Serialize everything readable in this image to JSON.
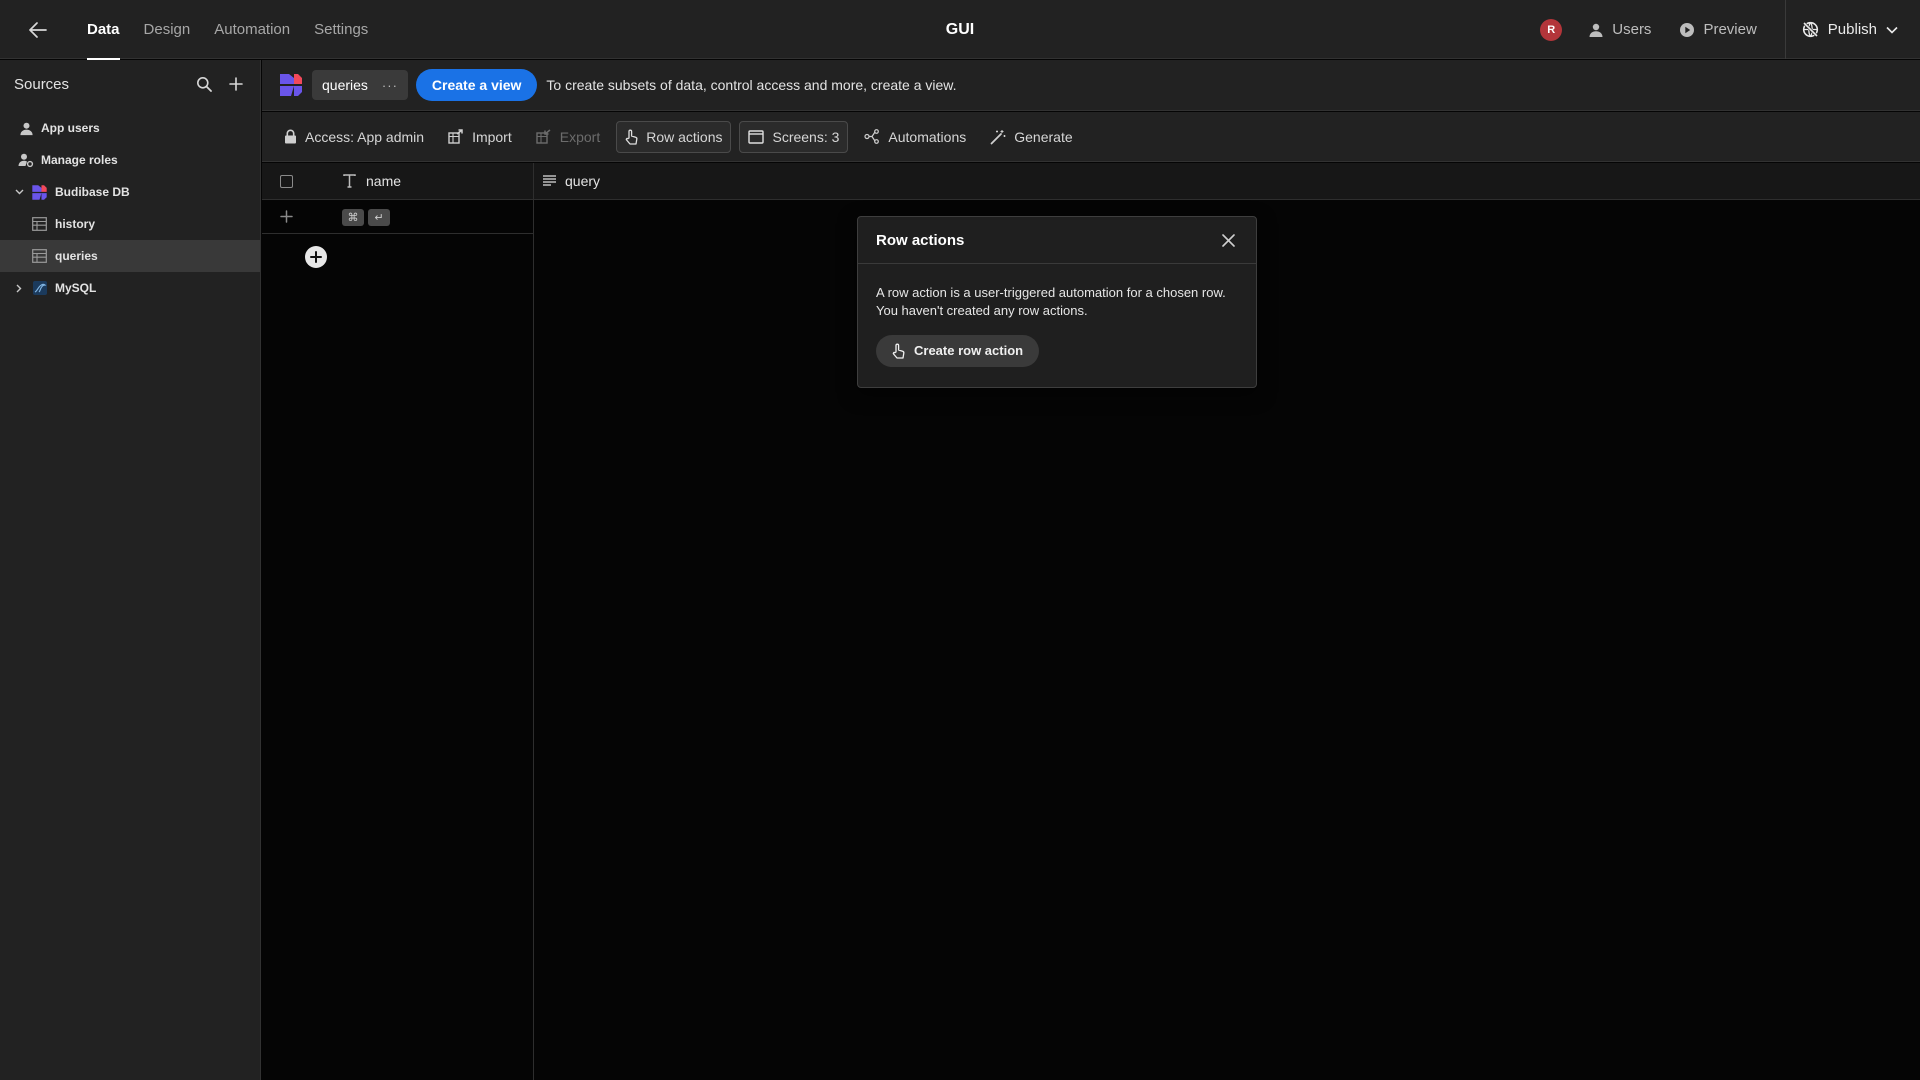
{
  "topnav": {
    "tabs": [
      {
        "label": "Data",
        "active": true
      },
      {
        "label": "Design",
        "active": false
      },
      {
        "label": "Automation",
        "active": false
      },
      {
        "label": "Settings",
        "active": false
      }
    ],
    "app_title": "GUI",
    "avatar_initial": "R",
    "users_label": "Users",
    "preview_label": "Preview",
    "publish_label": "Publish"
  },
  "sidebar": {
    "title": "Sources",
    "items": [
      {
        "label": "App users",
        "icon": "user-icon"
      },
      {
        "label": "Manage roles",
        "icon": "roles-icon"
      },
      {
        "label": "Budibase DB",
        "icon": "budibase-logo",
        "expanded": true
      },
      {
        "label": "history",
        "icon": "table-icon"
      },
      {
        "label": "queries",
        "icon": "table-icon",
        "selected": true
      },
      {
        "label": "MySQL",
        "icon": "mysql-icon",
        "expanded": false
      }
    ]
  },
  "viewbar": {
    "table_name": "queries",
    "more_label": "···",
    "create_view_label": "Create a view",
    "hint": "To create subsets of data, control access and more, create a view."
  },
  "toolbar": {
    "access_label": "Access: App admin",
    "import_label": "Import",
    "export_label": "Export",
    "row_actions_label": "Row actions",
    "screens_label": "Screens: 3",
    "automations_label": "Automations",
    "generate_label": "Generate"
  },
  "grid": {
    "columns": [
      {
        "label": "name",
        "type_icon": "text-type-icon"
      },
      {
        "label": "query",
        "type_icon": "longform-type-icon"
      }
    ],
    "shortcut_keys": [
      "⌘",
      "↵"
    ]
  },
  "popover": {
    "title": "Row actions",
    "line1": "A row action is a user-triggered automation for a chosen row.",
    "line2": "You haven't created any row actions.",
    "button_label": "Create row action"
  },
  "colors": {
    "accent": "#1a72e6",
    "avatar": "#b3353a",
    "panel": "#222222",
    "canvas": "#050505"
  }
}
